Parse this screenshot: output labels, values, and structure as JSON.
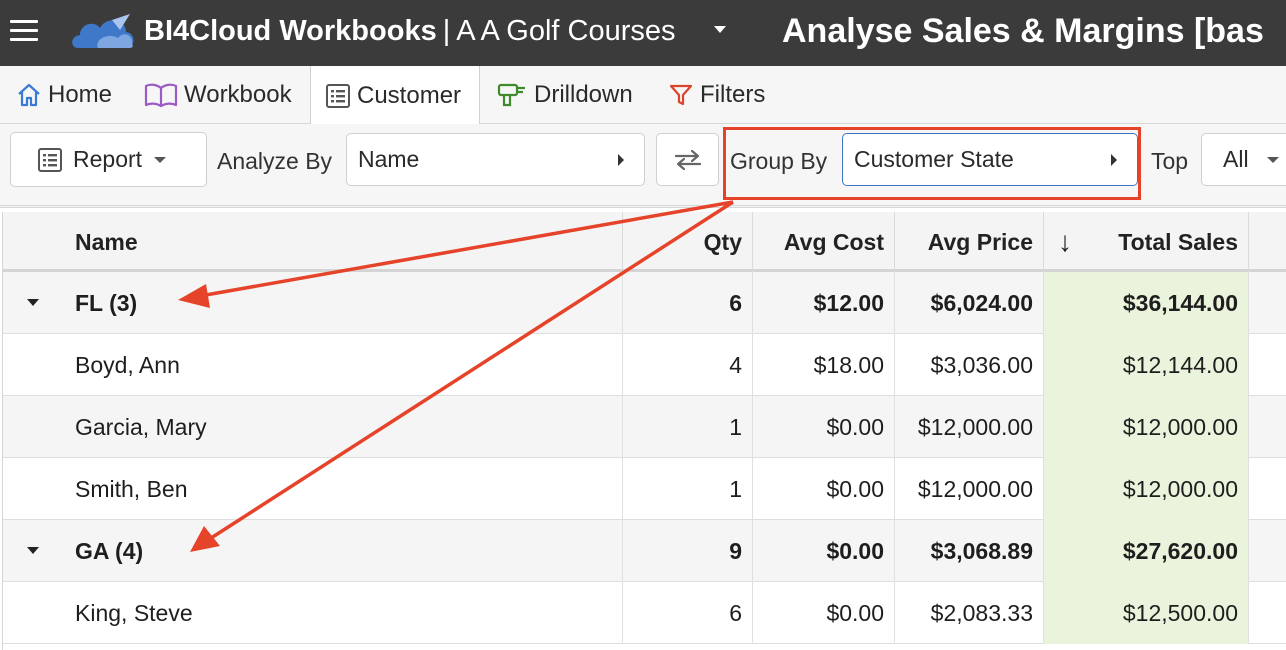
{
  "header": {
    "app_name": "BI4Cloud Workbooks",
    "separator": "|",
    "workspace": "A A Golf Courses",
    "page_title": "Analyse Sales & Margins [bas"
  },
  "ribbon": {
    "tabs": [
      {
        "label": "Home",
        "icon": "home-icon"
      },
      {
        "label": "Workbook",
        "icon": "book-icon"
      },
      {
        "label": "Customer",
        "icon": "list-icon",
        "active": true
      },
      {
        "label": "Drilldown",
        "icon": "drill-icon"
      },
      {
        "label": "Filters",
        "icon": "filter-icon"
      }
    ]
  },
  "toolbar": {
    "report_label": "Report",
    "analyze_by_label": "Analyze By",
    "analyze_by_value": "Name",
    "group_by_label": "Group By",
    "group_by_value": "Customer State",
    "top_label": "Top",
    "top_value": "All"
  },
  "table": {
    "columns": [
      "Name",
      "Qty",
      "Avg Cost",
      "Avg Price",
      "Total Sales"
    ],
    "sort_indicator": "↓",
    "rows": [
      {
        "type": "group",
        "name": "FL (3)",
        "qty": "6",
        "avg_cost": "$12.00",
        "avg_price": "$6,024.00",
        "total_sales": "$36,144.00"
      },
      {
        "type": "item",
        "name": "Boyd, Ann",
        "qty": "4",
        "avg_cost": "$18.00",
        "avg_price": "$3,036.00",
        "total_sales": "$12,144.00"
      },
      {
        "type": "item",
        "name": "Garcia, Mary",
        "qty": "1",
        "avg_cost": "$0.00",
        "avg_price": "$12,000.00",
        "total_sales": "$12,000.00"
      },
      {
        "type": "item",
        "name": "Smith, Ben",
        "qty": "1",
        "avg_cost": "$0.00",
        "avg_price": "$12,000.00",
        "total_sales": "$12,000.00"
      },
      {
        "type": "group",
        "name": "GA (4)",
        "qty": "9",
        "avg_cost": "$0.00",
        "avg_price": "$3,068.89",
        "total_sales": "$27,620.00"
      },
      {
        "type": "item",
        "name": "King, Steve",
        "qty": "6",
        "avg_cost": "$0.00",
        "avg_price": "$2,083.33",
        "total_sales": "$12,500.00"
      }
    ]
  },
  "colors": {
    "titlebar": "#3b3b3b",
    "annotation": "#e5432a",
    "sales_highlight": "#eaf4dc"
  }
}
